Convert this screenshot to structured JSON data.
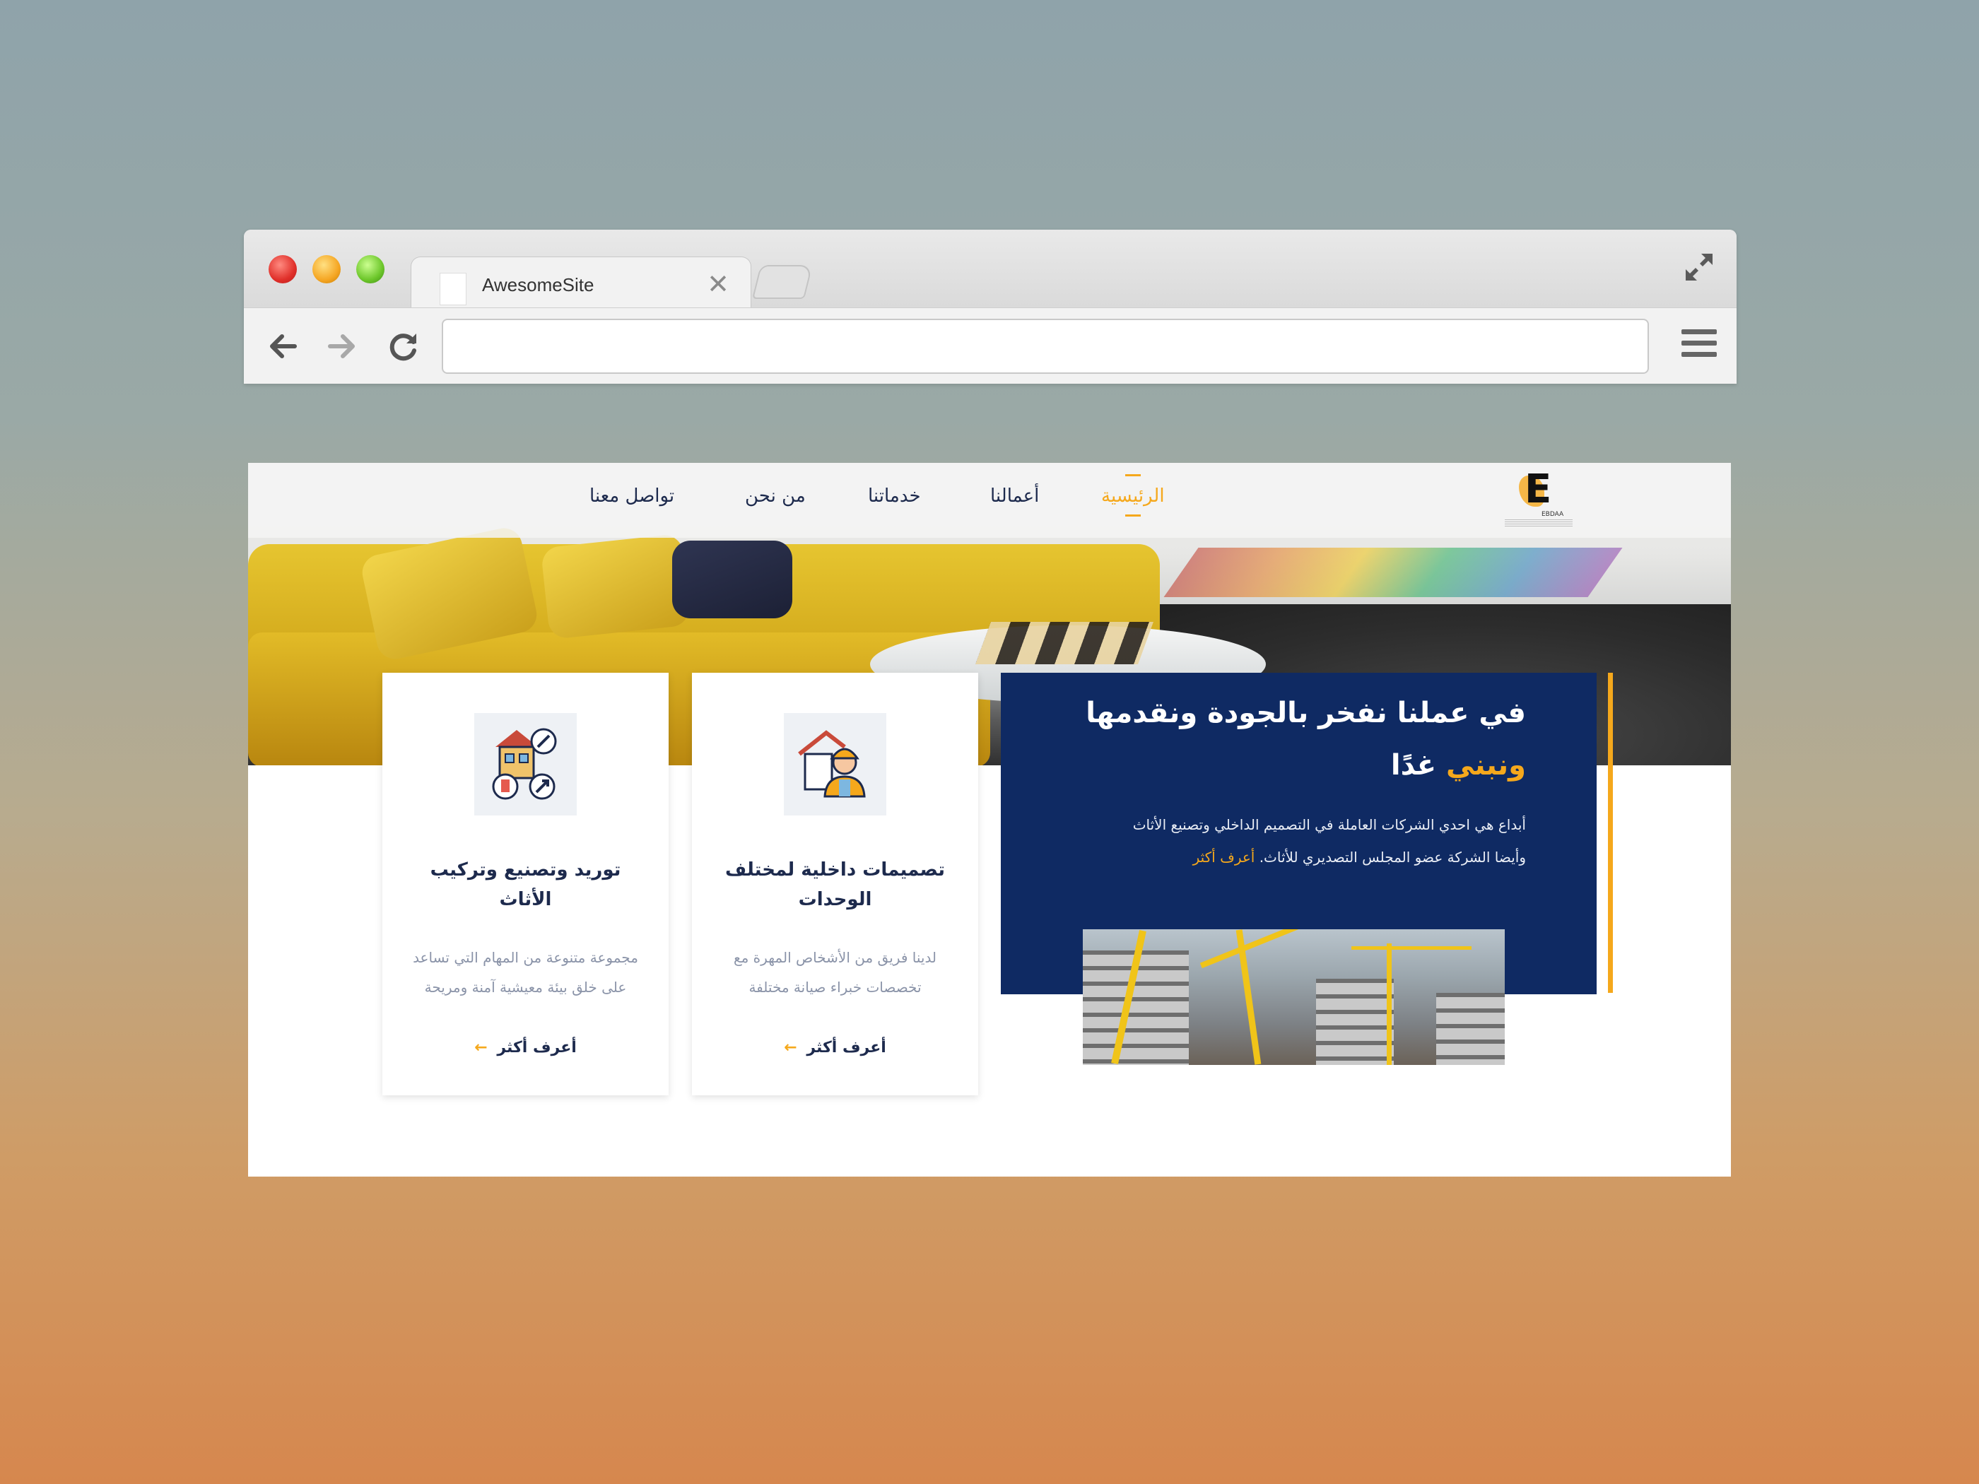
{
  "browser": {
    "tab_title": "AwesomeSite",
    "tab_close": "✕",
    "url": ""
  },
  "site": {
    "logo_text": "E",
    "logo_name": "EBDAA",
    "nav": [
      {
        "label": "الرئيسية",
        "active": true
      },
      {
        "label": "أعمالنا"
      },
      {
        "label": "خدماتنا"
      },
      {
        "label": "من نحن"
      },
      {
        "label": "تواصل معنا"
      }
    ],
    "hero": {
      "title_line1": "في عملنا نفخر بالجودة ونقدمها",
      "title_line2_highlight": "ونبني",
      "title_line2_rest": "غدًا",
      "text": "أبداع هي احدي الشركات العاملة في التصميم الداخلي وتصنيع الأثاث وأيضا الشركة عضو المجلس التصديري للأثاث.",
      "more_link": "أعرف أكثر"
    },
    "cards": [
      {
        "icon": "furniture-tools-icon",
        "title": "توريد وتصنيع وتركيب الأثاث",
        "text": "مجموعة متنوعة من المهام التي تساعد على خلق بيئة معيشية آمنة ومريحة",
        "link": "أعرف أكثر"
      },
      {
        "icon": "worker-house-icon",
        "title": "تصميمات داخلية لمختلف الوحدات",
        "text": "لدينا فريق من الأشخاص المهرة مع تخصصات خبراء صيانة مختلفة",
        "link": "أعرف أكثر"
      }
    ]
  },
  "colors": {
    "accent": "#f5a81c",
    "navy": "#0f2a63",
    "text_dark": "#1d2a4d",
    "text_muted": "#8a93a8"
  }
}
